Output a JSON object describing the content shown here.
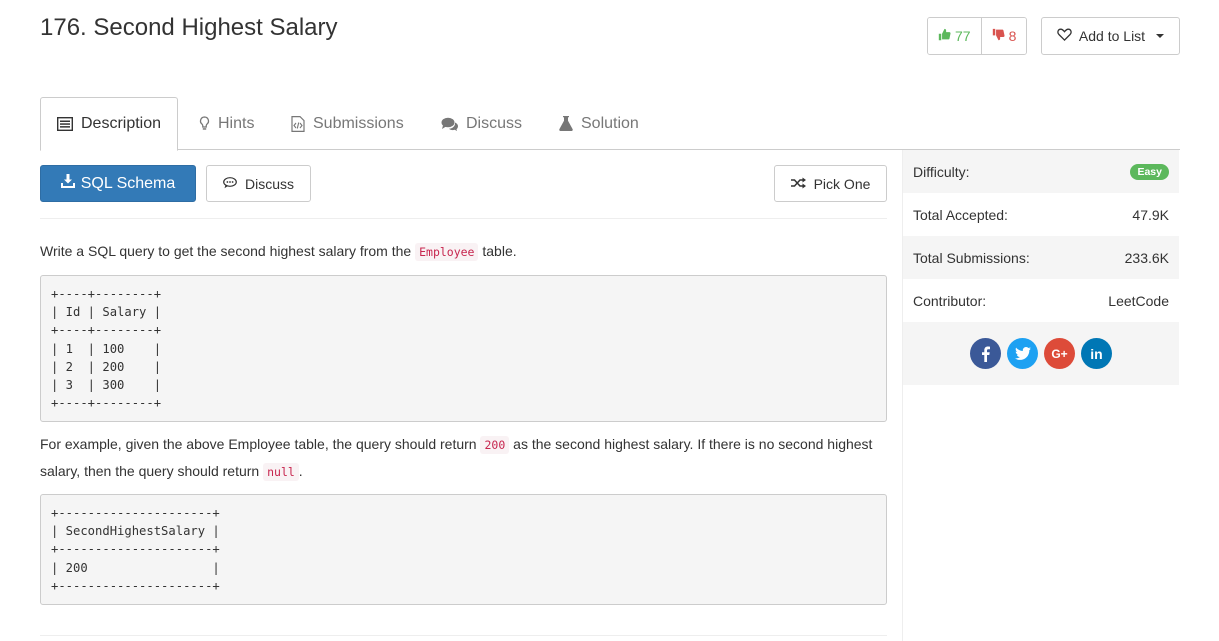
{
  "problem": {
    "title": "176. Second Highest Salary"
  },
  "votes": {
    "up": "77",
    "down": "8"
  },
  "add_list": {
    "label": "Add to List"
  },
  "tabs": [
    {
      "label": "Description",
      "icon": "list-icon"
    },
    {
      "label": "Hints",
      "icon": "lightbulb-icon"
    },
    {
      "label": "Submissions",
      "icon": "code-file-icon"
    },
    {
      "label": "Discuss",
      "icon": "comments-icon"
    },
    {
      "label": "Solution",
      "icon": "flask-icon"
    }
  ],
  "toolbar": {
    "sql_schema": "SQL Schema",
    "discuss": "Discuss",
    "pick_one": "Pick One"
  },
  "description": {
    "line1_before": "Write a SQL query to get the second highest salary from the ",
    "line1_code": "Employee",
    "line1_after": " table.",
    "table_example": "+----+--------+\n| Id | Salary |\n+----+--------+\n| 1  | 100    |\n| 2  | 200    |\n| 3  | 300    |\n+----+--------+",
    "line2_a": "For example, given the above Employee table, the query should return ",
    "line2_code1": "200",
    "line2_b": " as the second highest salary. If there is no second highest",
    "line2_c": "salary, then the query should return ",
    "line2_code2": "null",
    "line2_d": ".",
    "result_example": "+---------------------+\n| SecondHighestSalary |\n+---------------------+\n| 200                 |\n+---------------------+"
  },
  "sidebar": {
    "difficulty_label": "Difficulty:",
    "difficulty_value": "Easy",
    "accepted_label": "Total Accepted:",
    "accepted_value": "47.9K",
    "submissions_label": "Total Submissions:",
    "submissions_value": "233.6K",
    "contributor_label": "Contributor:",
    "contributor_value": "LeetCode"
  },
  "social": [
    {
      "name": "facebook",
      "glyph": "f",
      "color": "#3b5998"
    },
    {
      "name": "twitter",
      "glyph": "t",
      "color": "#1da1f2"
    },
    {
      "name": "google-plus",
      "glyph": "G+",
      "color": "#dd4b39"
    },
    {
      "name": "linkedin",
      "glyph": "in",
      "color": "#0077b5"
    }
  ]
}
